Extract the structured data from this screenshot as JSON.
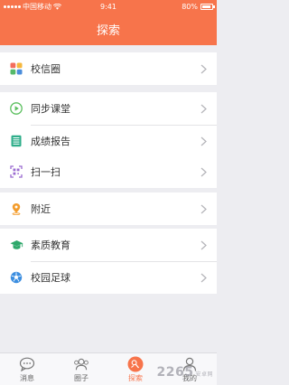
{
  "status_bar": {
    "carrier": "中国移动",
    "time": "9:41",
    "battery": "80%"
  },
  "nav": {
    "title": "探索"
  },
  "sections": [
    {
      "items": [
        {
          "label": "校信圈",
          "icon": "grid-squares-icon"
        }
      ]
    },
    {
      "items": [
        {
          "label": "同步课堂",
          "icon": "play-circle-icon"
        },
        {
          "label": "成绩报告",
          "icon": "report-icon"
        }
      ]
    },
    {
      "items": [
        {
          "label": "扫一扫",
          "icon": "scan-icon"
        }
      ]
    },
    {
      "items": [
        {
          "label": "附近",
          "icon": "location-pin-icon"
        }
      ]
    },
    {
      "items": [
        {
          "label": "素质教育",
          "icon": "graduation-cap-icon"
        },
        {
          "label": "校园足球",
          "icon": "soccer-ball-icon"
        }
      ]
    }
  ],
  "tabs": [
    {
      "label": "消息",
      "icon": "chat-bubble-icon",
      "active": false
    },
    {
      "label": "圈子",
      "icon": "people-icon",
      "active": false
    },
    {
      "label": "探索",
      "icon": "explore-icon",
      "active": true
    },
    {
      "label": "我的",
      "icon": "person-icon",
      "active": false
    }
  ],
  "watermark": {
    "text": "2265",
    "sub": "安卓网"
  },
  "colors": {
    "accent": "#f7744b",
    "background": "#ededf1"
  }
}
